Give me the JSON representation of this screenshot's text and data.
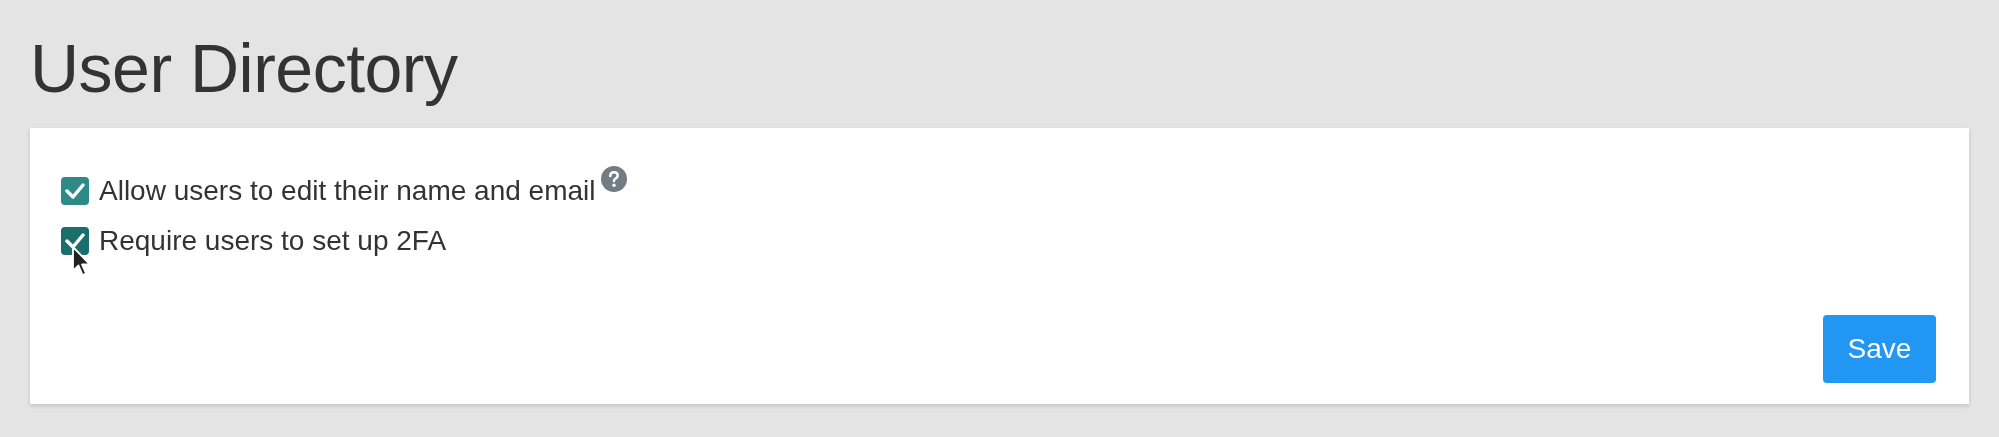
{
  "page_title": "User Directory",
  "options": [
    {
      "label": "Allow users to edit their name and email",
      "checked": true,
      "hovered": false,
      "help": true
    },
    {
      "label": "Require users to set up 2FA",
      "checked": true,
      "hovered": true,
      "help": false
    }
  ],
  "save_button": "Save"
}
